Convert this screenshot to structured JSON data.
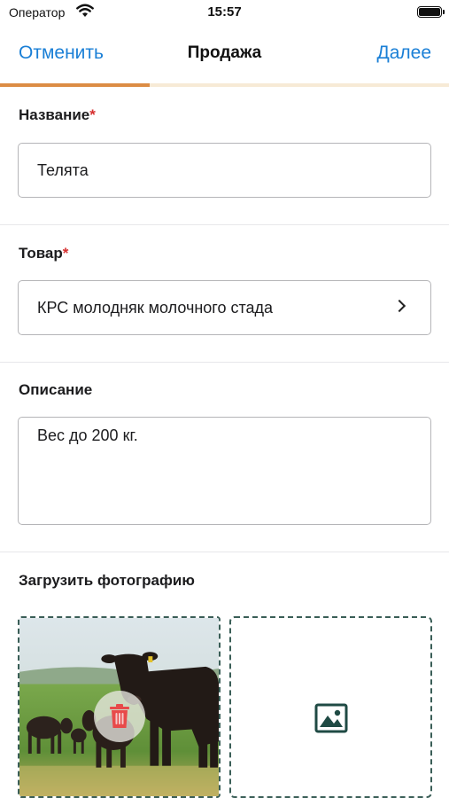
{
  "status_bar": {
    "carrier": "Оператор",
    "time": "15:57"
  },
  "nav": {
    "cancel_label": "Отменить",
    "title": "Продажа",
    "next_label": "Далее"
  },
  "progress": {
    "fraction": 0.333,
    "fill_color": "#dc8c44",
    "track_color": "#f7ead6"
  },
  "form": {
    "name": {
      "label": "Название",
      "required_mark": "*",
      "value": "Телята"
    },
    "product": {
      "label": "Товар",
      "required_mark": "*",
      "value": "КРС молодняк молочного стада"
    },
    "description": {
      "label": "Описание",
      "value": "Вес до 200 кг."
    },
    "photos": {
      "label": "Загрузить фотографию"
    }
  },
  "icons": {
    "wifi": "wifi-icon",
    "battery": "battery-icon",
    "chevron": "chevron-right-icon",
    "trash": "trash-icon",
    "add_photo": "image-add-icon"
  },
  "colors": {
    "accent": "#1a7fd6",
    "required": "#d62f2f",
    "trash": "#e84a4a",
    "tile_border": "#3a5e57"
  }
}
